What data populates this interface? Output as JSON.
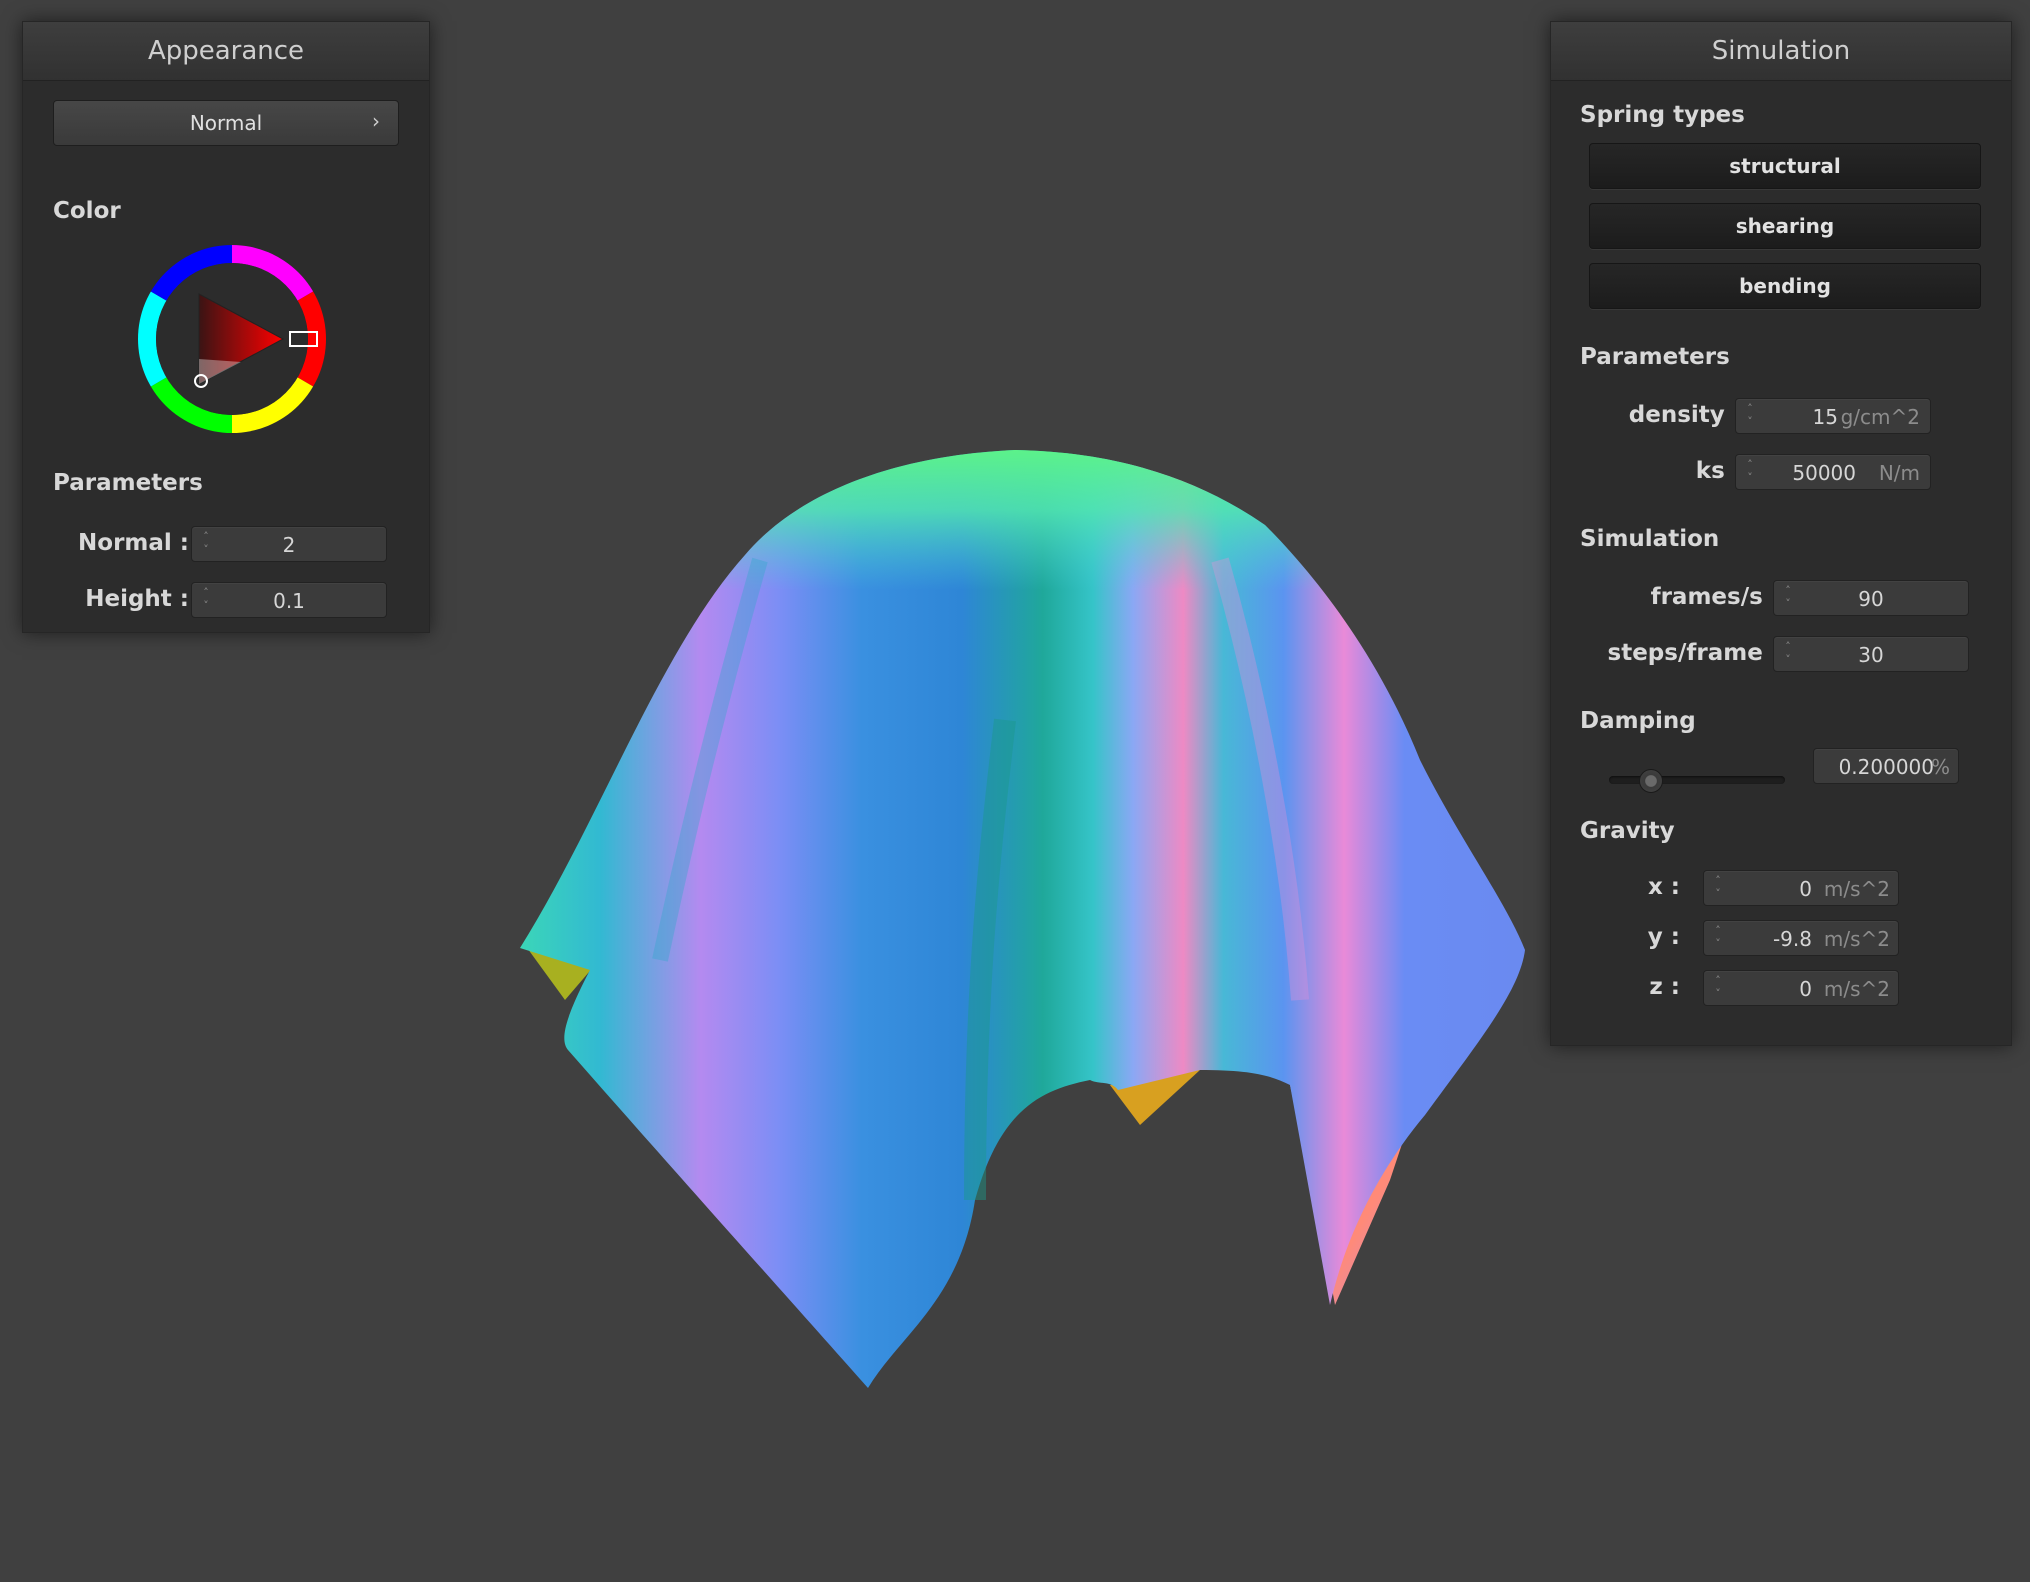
{
  "appearance": {
    "title": "Appearance",
    "shader_select": {
      "value": "Normal",
      "arrow": "›"
    },
    "color_label": "Color",
    "parameters_label": "Parameters",
    "normal": {
      "label": "Normal :",
      "value": "2"
    },
    "height": {
      "label": "Height :",
      "value": "0.1"
    }
  },
  "simulation": {
    "title": "Simulation",
    "spring_types_label": "Spring types",
    "springs": [
      "structural",
      "shearing",
      "bending"
    ],
    "parameters_label": "Parameters",
    "density": {
      "label": "density :",
      "value": "15",
      "unit": "g/cm^2"
    },
    "ks": {
      "label": "ks :",
      "value": "50000",
      "unit": "N/m"
    },
    "simulation_label": "Simulation",
    "frames": {
      "label": "frames/s :",
      "value": "90"
    },
    "steps": {
      "label": "steps/frame :",
      "value": "30"
    },
    "damping_label": "Damping",
    "damping": {
      "value": "0.200000",
      "unit": "%",
      "slider_fraction": 0.2
    },
    "gravity_label": "Gravity",
    "gx": {
      "label": "x :",
      "value": "0",
      "unit": "m/s^2"
    },
    "gy": {
      "label": "y :",
      "value": "-9.8",
      "unit": "m/s^2"
    },
    "gz": {
      "label": "z :",
      "value": "0",
      "unit": "m/s^2"
    }
  },
  "colors": {
    "background": "#404040",
    "panel": "#2c2c2c",
    "selected_color": "#ff0000"
  }
}
